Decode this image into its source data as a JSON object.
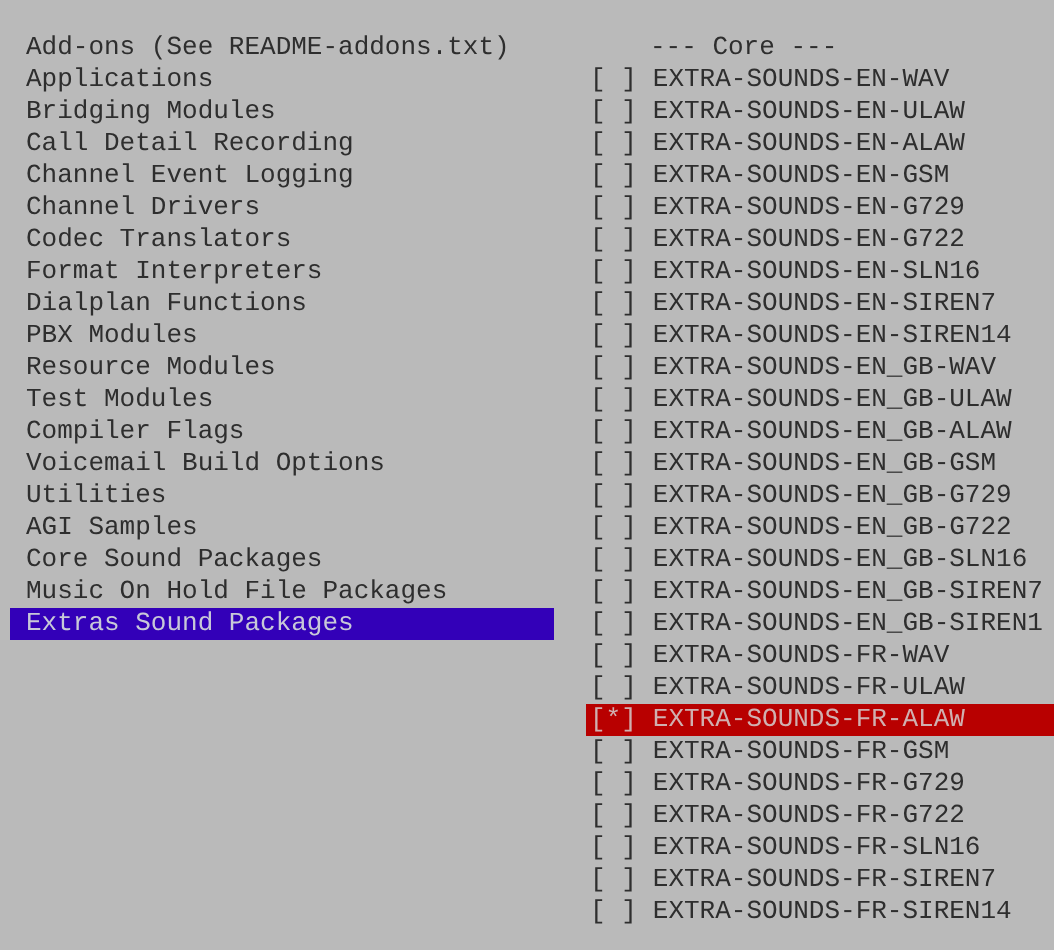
{
  "categories": {
    "heading": "Add-ons (See README-addons.txt)",
    "items": [
      {
        "label": "Applications",
        "selected": false
      },
      {
        "label": "Bridging Modules",
        "selected": false
      },
      {
        "label": "Call Detail Recording",
        "selected": false
      },
      {
        "label": "Channel Event Logging",
        "selected": false
      },
      {
        "label": "Channel Drivers",
        "selected": false
      },
      {
        "label": "Codec Translators",
        "selected": false
      },
      {
        "label": "Format Interpreters",
        "selected": false
      },
      {
        "label": "Dialplan Functions",
        "selected": false
      },
      {
        "label": "PBX Modules",
        "selected": false
      },
      {
        "label": "Resource Modules",
        "selected": false
      },
      {
        "label": "Test Modules",
        "selected": false
      },
      {
        "label": "Compiler Flags",
        "selected": false
      },
      {
        "label": "Voicemail Build Options",
        "selected": false
      },
      {
        "label": "Utilities",
        "selected": false
      },
      {
        "label": "AGI Samples",
        "selected": false
      },
      {
        "label": "Core Sound Packages",
        "selected": false
      },
      {
        "label": "Music On Hold File Packages",
        "selected": false
      },
      {
        "label": "Extras Sound Packages",
        "selected": true
      }
    ]
  },
  "options": {
    "heading": "--- Core ---",
    "checkbox_on": "[*]",
    "checkbox_off": "[ ]",
    "items": [
      {
        "label": "EXTRA-SOUNDS-EN-WAV",
        "checked": false,
        "selected": false
      },
      {
        "label": "EXTRA-SOUNDS-EN-ULAW",
        "checked": false,
        "selected": false
      },
      {
        "label": "EXTRA-SOUNDS-EN-ALAW",
        "checked": false,
        "selected": false
      },
      {
        "label": "EXTRA-SOUNDS-EN-GSM",
        "checked": false,
        "selected": false
      },
      {
        "label": "EXTRA-SOUNDS-EN-G729",
        "checked": false,
        "selected": false
      },
      {
        "label": "EXTRA-SOUNDS-EN-G722",
        "checked": false,
        "selected": false
      },
      {
        "label": "EXTRA-SOUNDS-EN-SLN16",
        "checked": false,
        "selected": false
      },
      {
        "label": "EXTRA-SOUNDS-EN-SIREN7",
        "checked": false,
        "selected": false
      },
      {
        "label": "EXTRA-SOUNDS-EN-SIREN14",
        "checked": false,
        "selected": false
      },
      {
        "label": "EXTRA-SOUNDS-EN_GB-WAV",
        "checked": false,
        "selected": false
      },
      {
        "label": "EXTRA-SOUNDS-EN_GB-ULAW",
        "checked": false,
        "selected": false
      },
      {
        "label": "EXTRA-SOUNDS-EN_GB-ALAW",
        "checked": false,
        "selected": false
      },
      {
        "label": "EXTRA-SOUNDS-EN_GB-GSM",
        "checked": false,
        "selected": false
      },
      {
        "label": "EXTRA-SOUNDS-EN_GB-G729",
        "checked": false,
        "selected": false
      },
      {
        "label": "EXTRA-SOUNDS-EN_GB-G722",
        "checked": false,
        "selected": false
      },
      {
        "label": "EXTRA-SOUNDS-EN_GB-SLN16",
        "checked": false,
        "selected": false
      },
      {
        "label": "EXTRA-SOUNDS-EN_GB-SIREN7",
        "checked": false,
        "selected": false
      },
      {
        "label": "EXTRA-SOUNDS-EN_GB-SIREN1",
        "checked": false,
        "selected": false
      },
      {
        "label": "EXTRA-SOUNDS-FR-WAV",
        "checked": false,
        "selected": false
      },
      {
        "label": "EXTRA-SOUNDS-FR-ULAW",
        "checked": false,
        "selected": false
      },
      {
        "label": "EXTRA-SOUNDS-FR-ALAW",
        "checked": true,
        "selected": true
      },
      {
        "label": "EXTRA-SOUNDS-FR-GSM",
        "checked": false,
        "selected": false
      },
      {
        "label": "EXTRA-SOUNDS-FR-G729",
        "checked": false,
        "selected": false
      },
      {
        "label": "EXTRA-SOUNDS-FR-G722",
        "checked": false,
        "selected": false
      },
      {
        "label": "EXTRA-SOUNDS-FR-SLN16",
        "checked": false,
        "selected": false
      },
      {
        "label": "EXTRA-SOUNDS-FR-SIREN7",
        "checked": false,
        "selected": false
      },
      {
        "label": "EXTRA-SOUNDS-FR-SIREN14",
        "checked": false,
        "selected": false
      }
    ]
  }
}
